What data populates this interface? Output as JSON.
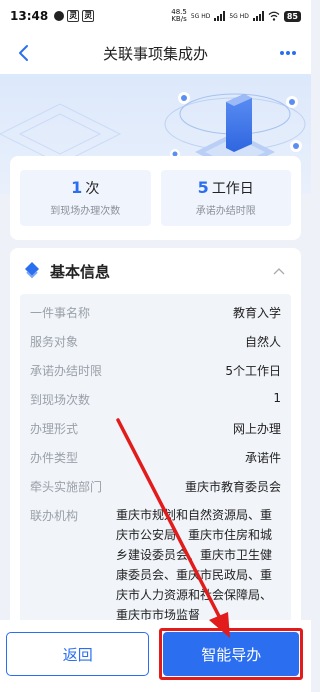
{
  "status_bar": {
    "time": "13:48",
    "notif1": "灵",
    "notif2": "灵",
    "speed_value": "48.5",
    "speed_unit": "KB/s",
    "net1": "5G HD",
    "net2": "5G HD",
    "battery": "85"
  },
  "nav": {
    "back_icon": "chevron-left-icon",
    "title": "关联事项集成办",
    "more_icon": "more-dots-icon"
  },
  "stats": [
    {
      "number": "1",
      "unit": "次",
      "label": "到现场办理次数"
    },
    {
      "number": "5",
      "unit": "工作日",
      "label": "承诺办结时限"
    }
  ],
  "basic_info": {
    "title": "基本信息",
    "rows": [
      {
        "label": "一件事名称",
        "value": "教育入学"
      },
      {
        "label": "服务对象",
        "value": "自然人"
      },
      {
        "label": "承诺办结时限",
        "value": "5个工作日"
      },
      {
        "label": "到现场次数",
        "value": "1"
      },
      {
        "label": "办理形式",
        "value": "网上办理"
      },
      {
        "label": "办件类型",
        "value": "承诺件"
      },
      {
        "label": "牵头实施部门",
        "value": "重庆市教育委员会"
      },
      {
        "label": "联办机构",
        "value": "重庆市规划和自然资源局、重庆市公安局、重庆市住房和城乡建设委员会、重庆市卫生健康委员会、重庆市民政局、重庆市人力资源和社会保障局、重庆市市场监督"
      }
    ]
  },
  "bottom": {
    "back_label": "返回",
    "guide_label": "智能导办"
  },
  "colors": {
    "accent": "#2b6ff0",
    "highlight": "#e21b1b"
  }
}
